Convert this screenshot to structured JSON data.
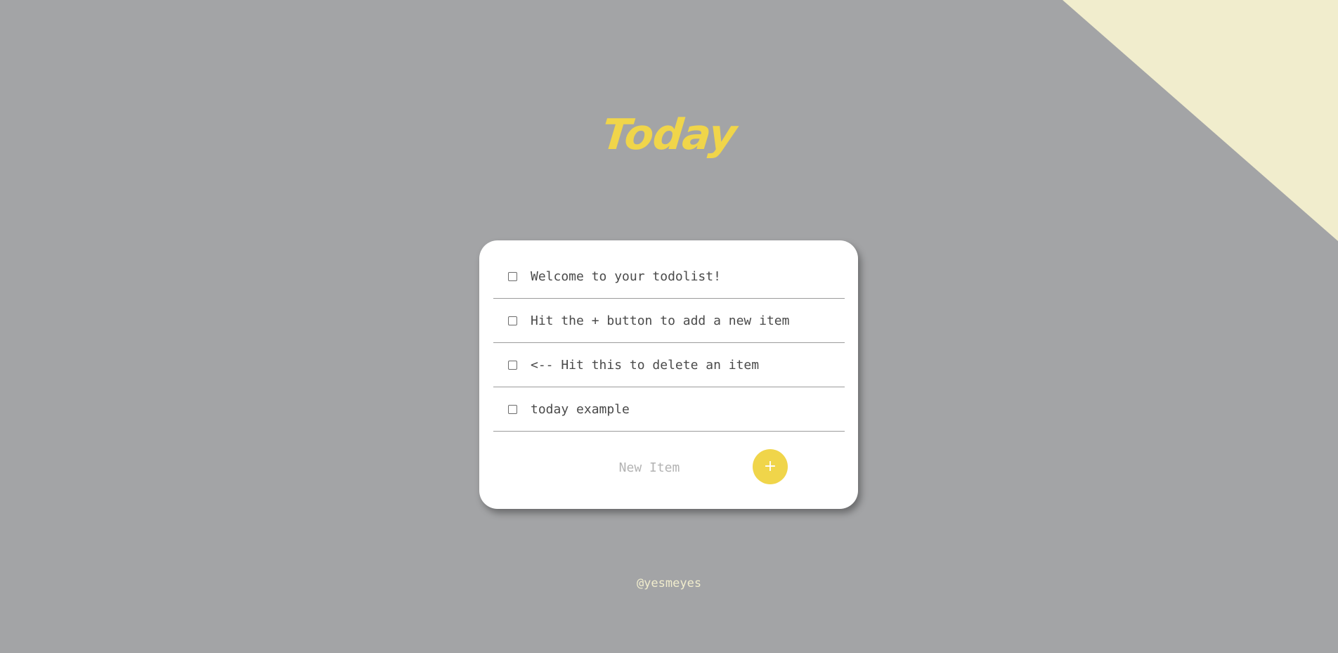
{
  "page": {
    "title": "Today",
    "colors": {
      "background": "#a3a4a6",
      "accent": "#f0d54a",
      "corner": "#f1edcd",
      "card": "#ffffff"
    }
  },
  "todo": {
    "items": [
      {
        "label": "Welcome to your todolist!",
        "checked": false
      },
      {
        "label": "Hit the + button to add a new item",
        "checked": false
      },
      {
        "label": "<-- Hit this to delete an item",
        "checked": false
      },
      {
        "label": "today example",
        "checked": false
      }
    ],
    "new_item_placeholder": "New Item",
    "new_item_value": "",
    "add_button_label": "+"
  },
  "footer": {
    "credit": "@yesmeyes"
  },
  "icons": {
    "checkbox": "checkbox-icon"
  }
}
